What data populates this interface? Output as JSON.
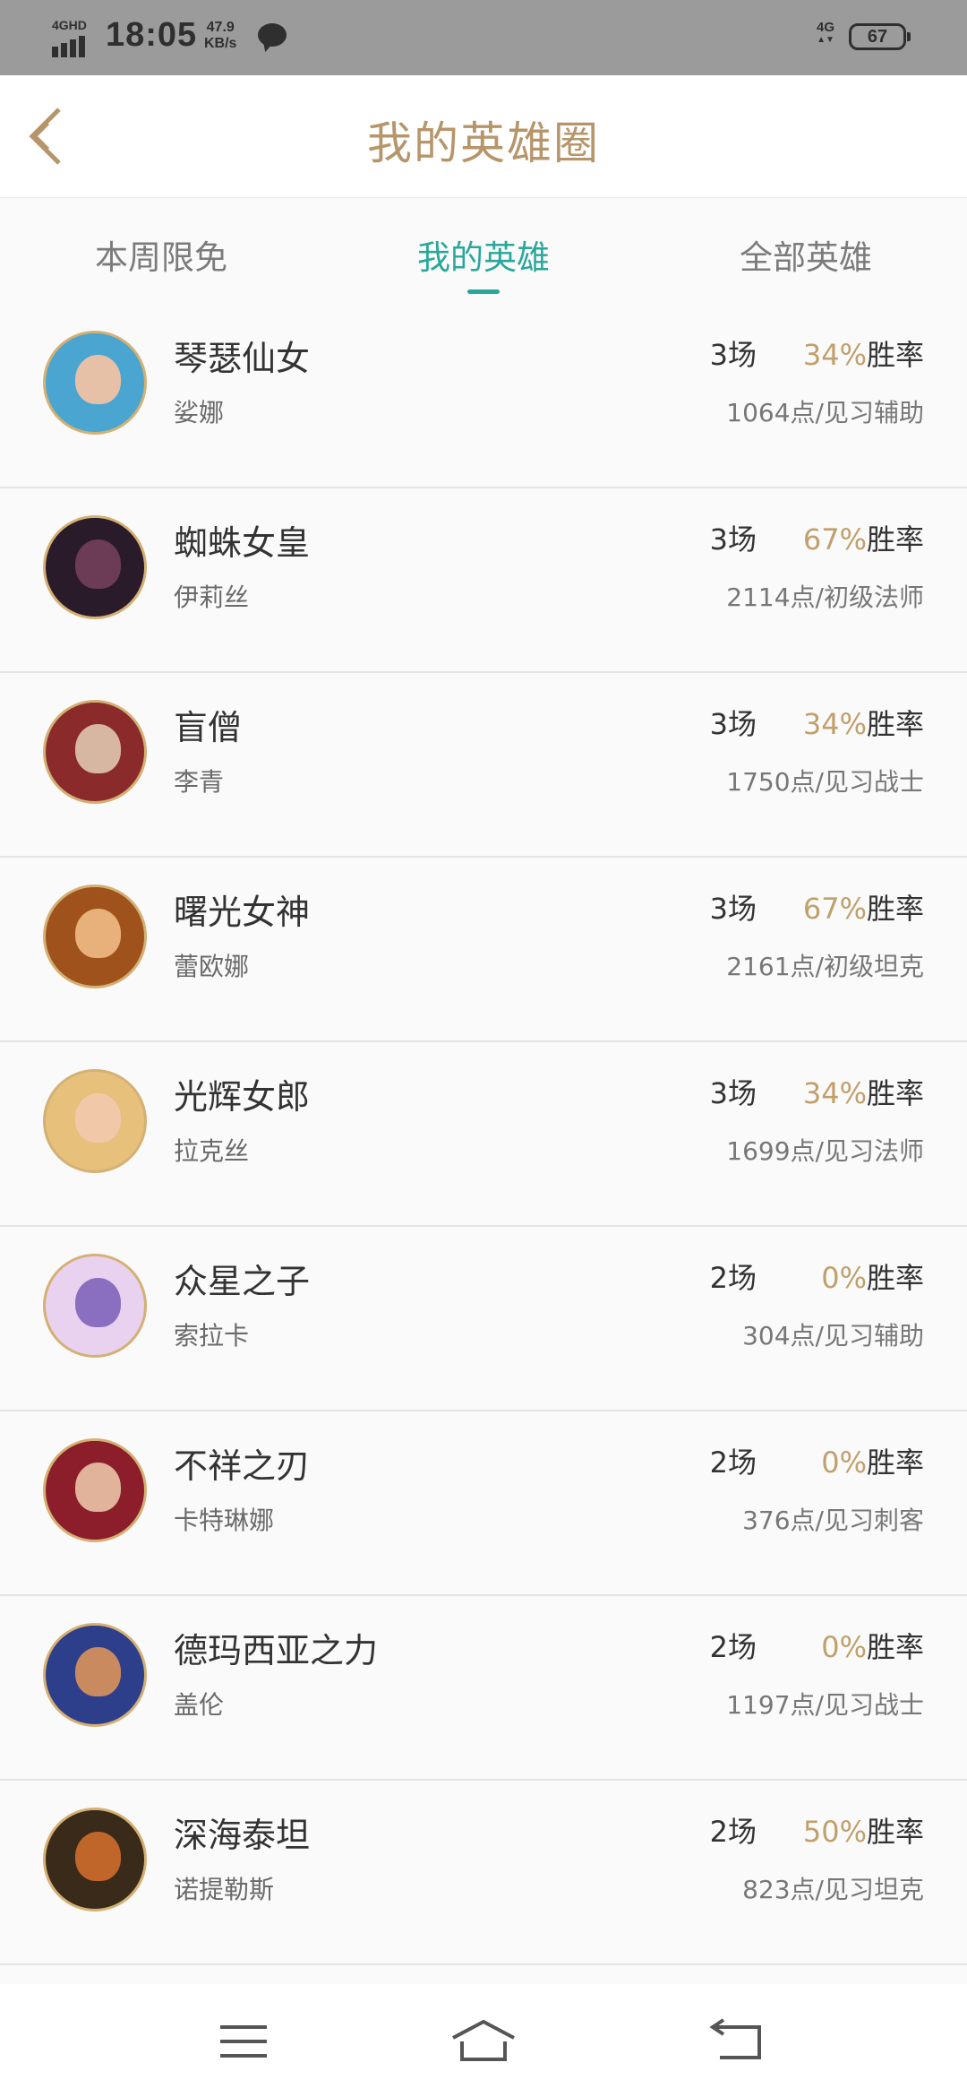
{
  "status": {
    "network": "4GHD",
    "time": "18:05",
    "speed_value": "47.9",
    "speed_unit": "KB/s",
    "net_type": "4G",
    "battery": "67"
  },
  "header": {
    "title": "我的英雄圈"
  },
  "tabs": [
    {
      "label": "本周限免"
    },
    {
      "label": "我的英雄"
    },
    {
      "label": "全部英雄"
    }
  ],
  "active_tab": "我的英雄",
  "win_rate_suffix": "胜率",
  "heroes": [
    {
      "title": "琴瑟仙女",
      "name": "娑娜",
      "games": "3场",
      "win_pct": "34%",
      "points": "1064点/见习辅助",
      "colors": [
        "#4aa6d0",
        "#e6c1a7"
      ]
    },
    {
      "title": "蜘蛛女皇",
      "name": "伊莉丝",
      "games": "3场",
      "win_pct": "67%",
      "points": "2114点/初级法师",
      "colors": [
        "#2a1b2a",
        "#6c3b55"
      ]
    },
    {
      "title": "盲僧",
      "name": "李青",
      "games": "3场",
      "win_pct": "34%",
      "points": "1750点/见习战士",
      "colors": [
        "#8b2a2a",
        "#d7b7a2"
      ]
    },
    {
      "title": "曙光女神",
      "name": "蕾欧娜",
      "games": "3场",
      "win_pct": "67%",
      "points": "2161点/初级坦克",
      "colors": [
        "#a0521d",
        "#e8b07a"
      ]
    },
    {
      "title": "光辉女郎",
      "name": "拉克丝",
      "games": "3场",
      "win_pct": "34%",
      "points": "1699点/见习法师",
      "colors": [
        "#e7c07c",
        "#f1c9a8"
      ]
    },
    {
      "title": "众星之子",
      "name": "索拉卡",
      "games": "2场",
      "win_pct": "0%",
      "points": "304点/见习辅助",
      "colors": [
        "#e9d2f0",
        "#8a6fc0"
      ]
    },
    {
      "title": "不祥之刃",
      "name": "卡特琳娜",
      "games": "2场",
      "win_pct": "0%",
      "points": "376点/见习刺客",
      "colors": [
        "#8c1d2a",
        "#e0b39a"
      ]
    },
    {
      "title": "德玛西亚之力",
      "name": "盖伦",
      "games": "2场",
      "win_pct": "0%",
      "points": "1197点/见习战士",
      "colors": [
        "#2d3f8a",
        "#c98a5f"
      ]
    },
    {
      "title": "深海泰坦",
      "name": "诺提勒斯",
      "games": "2场",
      "win_pct": "50%",
      "points": "823点/见习坦克",
      "colors": [
        "#3a2a1a",
        "#c0662a"
      ]
    }
  ]
}
